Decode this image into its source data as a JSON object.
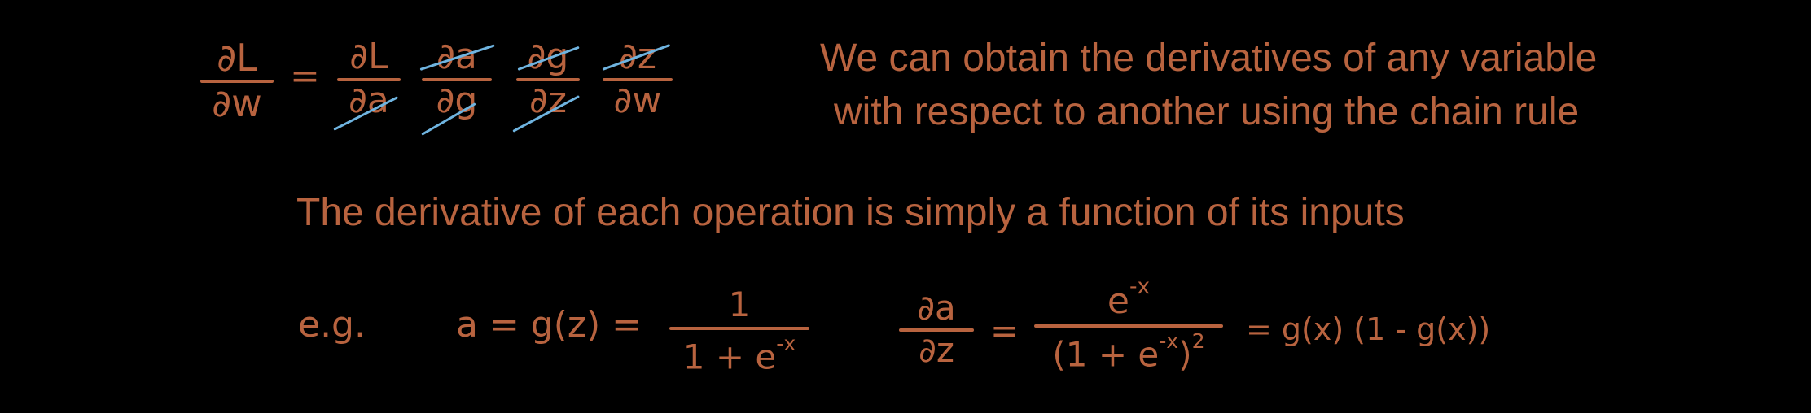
{
  "top_equation": {
    "lhs": {
      "num": "∂L",
      "den": "∂w"
    },
    "equals": "=",
    "factors": [
      {
        "num": "∂L",
        "den": "∂a"
      },
      {
        "num": "∂a",
        "den": "∂g"
      },
      {
        "num": "∂g",
        "den": "∂z"
      },
      {
        "num": "∂z",
        "den": "∂w"
      }
    ]
  },
  "chain_rule_text": {
    "line1": "We can obtain the derivatives of any variable",
    "line2": "with respect to another using the chain rule"
  },
  "operation_text": "The derivative of each operation is simply a function of its inputs",
  "example": {
    "label": "e.g.",
    "def_left": "a = g(z) =",
    "def_num": "1",
    "def_den_base": "1 + e",
    "def_den_exp": "-x",
    "deriv_num": "∂a",
    "deriv_den": "∂z",
    "deriv_equals": "=",
    "deriv_rhs_num_base": "e",
    "deriv_rhs_num_exp": "-x",
    "deriv_rhs_den_base": "(1 + e",
    "deriv_rhs_den_exp": "-x",
    "deriv_rhs_den_close": ")",
    "deriv_rhs_den_pow": "2",
    "deriv_result": "= g(x) (1 - g(x))"
  },
  "colors": {
    "background": "#000000",
    "ink": "#b8633f",
    "strike": "#6fb4e0"
  }
}
